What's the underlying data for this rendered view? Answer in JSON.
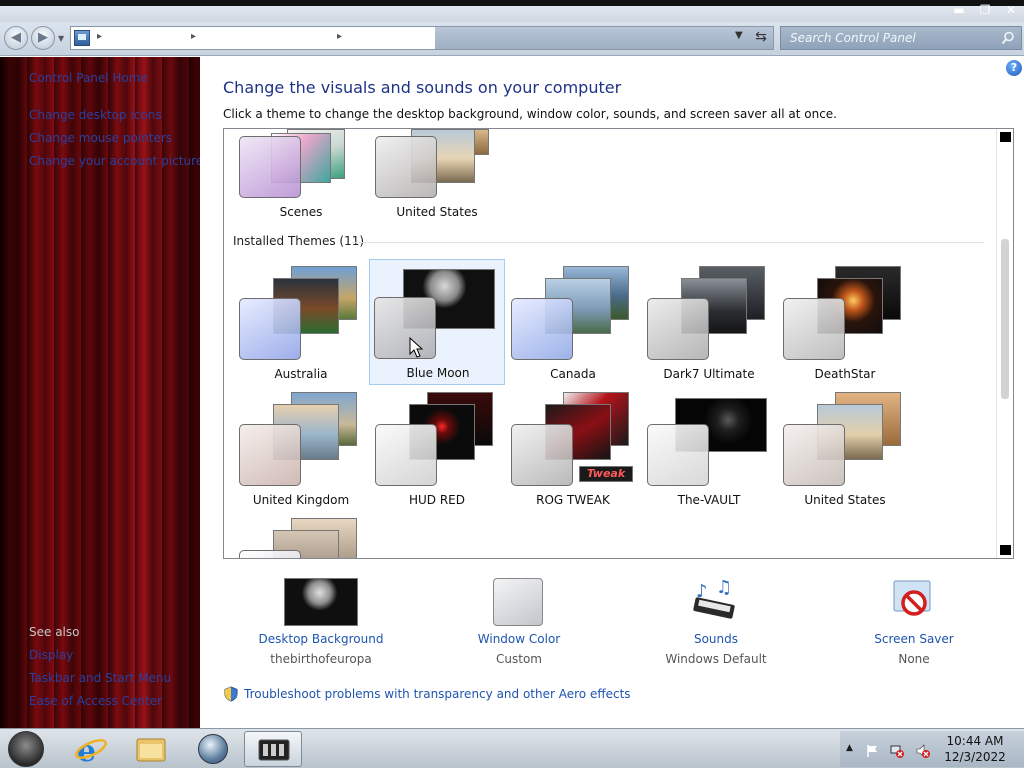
{
  "window": {
    "minimize": "▬",
    "maximize": "❐",
    "close": "✕"
  },
  "search": {
    "placeholder": "Search Control Panel"
  },
  "sidebar": {
    "home": "Control Panel Home",
    "tasks": [
      "Change desktop icons",
      "Change mouse pointers",
      "Change your account picture"
    ],
    "see_also_title": "See also",
    "see_also": [
      "Display",
      "Taskbar and Start Menu",
      "Ease of Access Center"
    ]
  },
  "main": {
    "title": "Change the visuals and sounds on your computer",
    "subtitle": "Click a theme to change the desktop background, window color, sounds, and screen saver all at once.",
    "top_themes": [
      "Scenes",
      "United States"
    ],
    "installed_header": "Installed Themes (11)",
    "installed": [
      "Australia",
      "Blue Moon",
      "Canada",
      "Dark7 Ultimate",
      "DeathStar",
      "United Kingdom",
      "HUD RED",
      "ROG TWEAK",
      "The-VAULT",
      "United States"
    ],
    "selected_theme": "Blue Moon",
    "tweak_badge": "Tweak"
  },
  "options": [
    {
      "title": "Desktop Background",
      "value": "thebirthofeuropa"
    },
    {
      "title": "Window Color",
      "value": "Custom"
    },
    {
      "title": "Sounds",
      "value": "Windows Default"
    },
    {
      "title": "Screen Saver",
      "value": "None"
    }
  ],
  "troubleshoot": "Troubleshoot problems with transparency and other Aero effects",
  "clock": {
    "time": "10:44 AM",
    "date": "12/3/2022"
  },
  "colors": {
    "link": "#1e55b0",
    "title": "#1e3287",
    "selection": "#eaf3fd"
  }
}
